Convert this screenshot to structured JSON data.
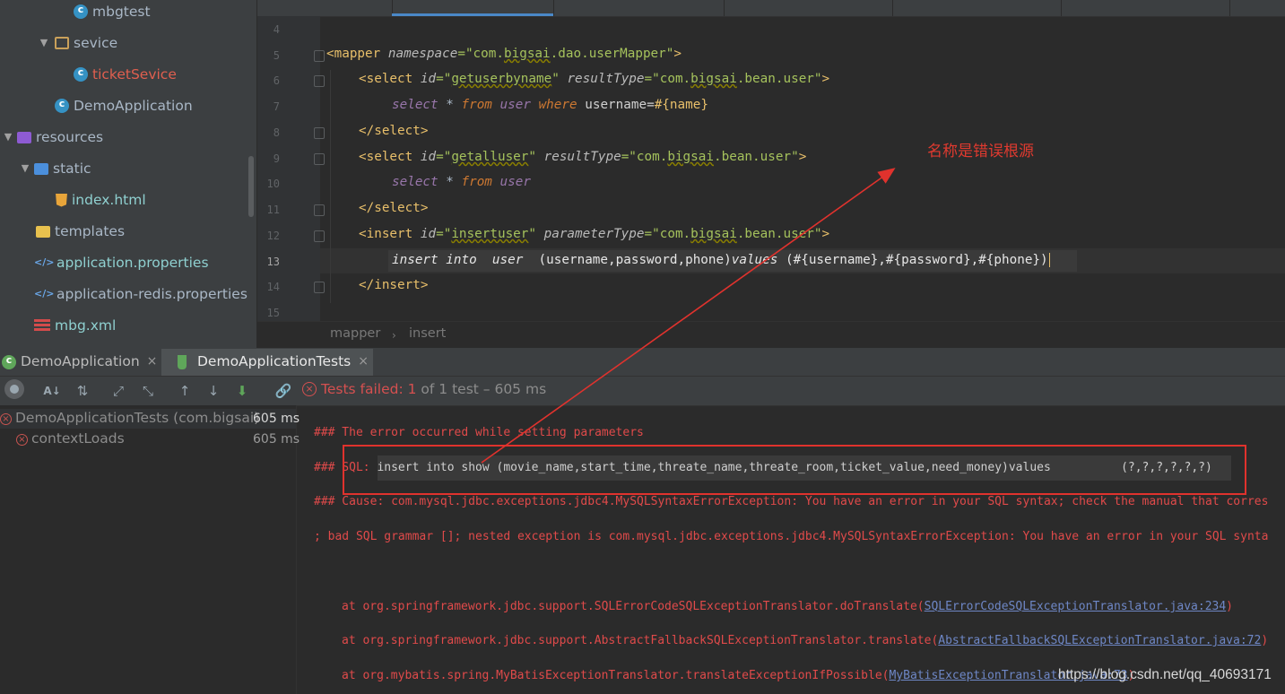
{
  "project_tree": {
    "items": [
      {
        "label": "mbgtest",
        "icon": "class-icon",
        "color": "#a9b7c6"
      },
      {
        "label": "sevice",
        "icon": "package-folder-icon",
        "color": "#a9b7c6"
      },
      {
        "label": "ticketSevice",
        "icon": "class-icon",
        "color": "#e05f4f"
      },
      {
        "label": "DemoApplication",
        "icon": "spring-class-icon",
        "color": "#a9b7c6"
      },
      {
        "label": "resources",
        "icon": "resources-folder-icon",
        "color": "#a9b7c6"
      },
      {
        "label": "static",
        "icon": "folder-icon",
        "color": "#a9b7c6"
      },
      {
        "label": "index.html",
        "icon": "html-file-icon",
        "color": "#8fd0d0"
      },
      {
        "label": "templates",
        "icon": "folder-icon",
        "color": "#a9b7c6"
      },
      {
        "label": "application.properties",
        "icon": "properties-file-icon",
        "color": "#8fd0d0"
      },
      {
        "label": "application-redis.properties",
        "icon": "properties-file-icon",
        "color": "#a9b7c6"
      },
      {
        "label": "mbg.xml",
        "icon": "xml-file-icon",
        "color": "#8fd0d0"
      }
    ]
  },
  "editor": {
    "line_numbers": [
      "4",
      "5",
      "6",
      "7",
      "8",
      "9",
      "10",
      "11",
      "12",
      "13",
      "14",
      "15"
    ],
    "lines": {
      "l5": {
        "open": "<mapper ",
        "attr": "namespace",
        "eq": "=",
        "val_pre": "\"com.",
        "val_u": "bigsai",
        "val_post": ".dao.userMapper\"",
        "close": ">"
      },
      "l6": {
        "open": "<select ",
        "attr1": "id",
        "eq": "=",
        "val1_pre": "\"",
        "val1_u": "getuserbyname",
        "val1_post": "\" ",
        "attr2": "resultType",
        "val2_pre": "\"com.",
        "val2_u": "bigsai",
        "val2_post": ".bean.user\"",
        "close": ">"
      },
      "l7": {
        "kw1": "select",
        "star": " * ",
        "kw2": "from",
        "tbl": " user ",
        "kw3": "where",
        "rest": " username=",
        "param": "#{name}"
      },
      "l8": {
        "text": "</select>"
      },
      "l9": {
        "open": "<select ",
        "attr1": "id",
        "eq": "=",
        "val1_pre": "\"",
        "val1_u": "getalluser",
        "val1_post": "\" ",
        "attr2": "resultType",
        "val2_pre": "\"com.",
        "val2_u": "bigsai",
        "val2_post": ".bean.user\"",
        "close": ">"
      },
      "l10": {
        "kw1": "select",
        "star": " * ",
        "kw2": "from",
        "tbl": " user"
      },
      "l11": {
        "text": "</select>"
      },
      "l12": {
        "open": "<insert ",
        "attr1": "id",
        "eq": "=",
        "val1_pre": "\"",
        "val1_u": "insertuser",
        "val1_post": "\" ",
        "attr2": "parameterType",
        "val2_pre": "\"com.",
        "val2_u": "bigsai",
        "val2_post": ".bean.user\"",
        "close": ">"
      },
      "l13": {
        "a": "insert into  user",
        "b": "  (username,password,phone)",
        "c": "values",
        "d": " (#{username},#{password},#{phone})"
      },
      "l14": {
        "text": "</insert>"
      }
    },
    "breadcrumb": [
      "mapper",
      "insert"
    ],
    "annotation": "名称是错误根源",
    "annotation_color": "#e03a2f"
  },
  "run_panel": {
    "tabs": [
      {
        "label": "DemoApplication",
        "close": "×"
      },
      {
        "label": "DemoApplicationTests",
        "close": "×"
      }
    ],
    "status": {
      "prefix": "Tests failed: ",
      "failed": "1",
      "rest": " of 1 test – 605 ms"
    },
    "tests": [
      {
        "label": "DemoApplicationTests (com.bigsai)",
        "duration": "605 ms"
      },
      {
        "label": "contextLoads",
        "duration": "605 ms"
      }
    ],
    "console": {
      "l1": "### The error occurred while setting parameters",
      "l2_prefix": "### SQL: ",
      "l2_sql": "insert into show (movie_name,start_time,threate_name,threate_room,ticket_value,need_money)values          (?,?,?,?,?,?)",
      "l3": "### Cause: com.mysql.jdbc.exceptions.jdbc4.MySQLSyntaxErrorException: You have an error in your SQL syntax; check the manual that corres",
      "l4": "; bad SQL grammar []; nested exception is com.mysql.jdbc.exceptions.jdbc4.MySQLSyntaxErrorException: You have an error in your SQL synta",
      "st1": "at org.springframework.jdbc.support.SQLErrorCodeSQLExceptionTranslator.doTranslate(",
      "st1_link": "SQLErrorCodeSQLExceptionTranslator.java:234",
      "st1_end": ")",
      "st2": "at org.springframework.jdbc.support.AbstractFallbackSQLExceptionTranslator.translate(",
      "st2_link": "AbstractFallbackSQLExceptionTranslator.java:72",
      "st2_end": ")",
      "st3": "at org.mybatis.spring.MyBatisExceptionTranslator.translateExceptionIfPossible(",
      "st3_link": "MyBatisExceptionTranslator.java:73",
      "st3_end": ")"
    },
    "highlight_box_color": "#e0322d"
  },
  "watermark": "https://blog.csdn.net/qq_40693171"
}
